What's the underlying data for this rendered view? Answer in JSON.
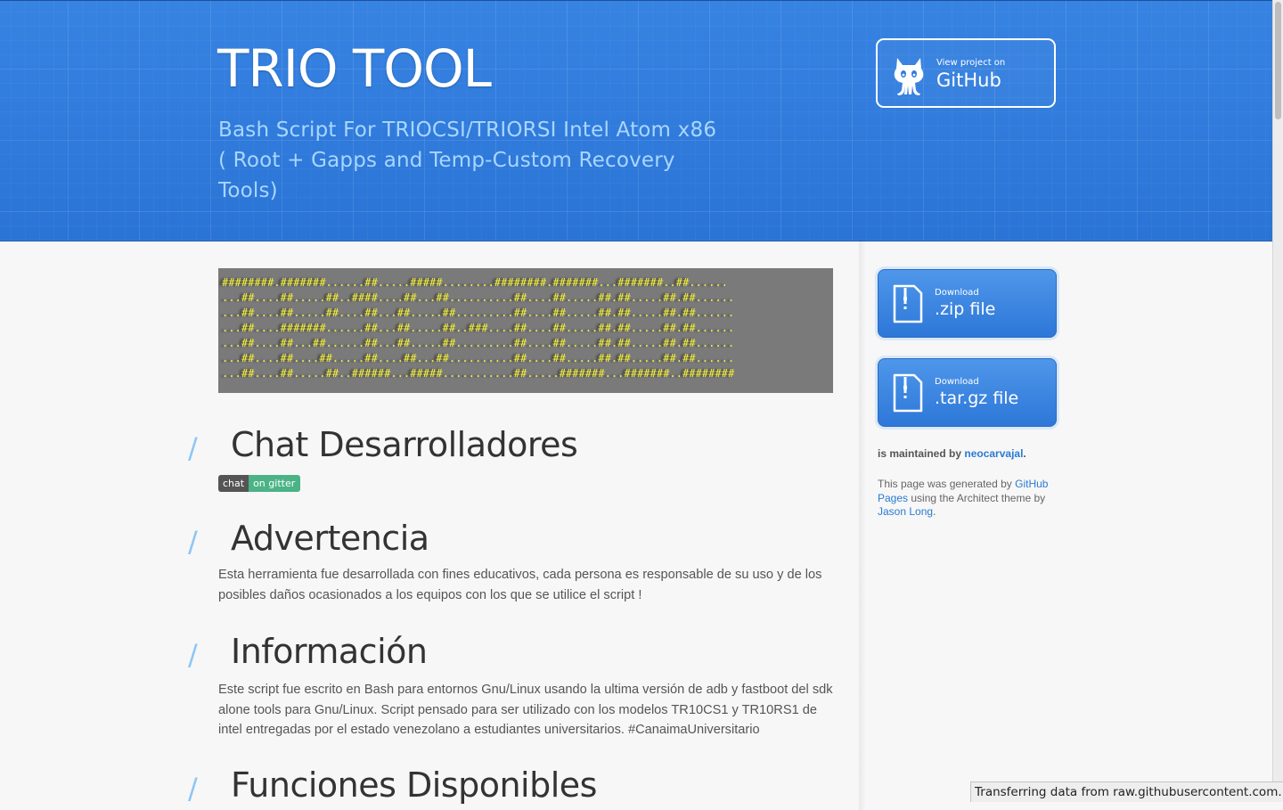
{
  "header": {
    "title": "TRIO TOOL",
    "subtitle": "Bash Script For TRIOCSI/TRIORSI Intel Atom x86 ( Root + Gapps and Temp-Custom Recovery Tools)",
    "github_button": {
      "small": "View project on",
      "big": "GitHub",
      "icon": "octocat-icon"
    }
  },
  "ascii_banner": [
    "########.#######......##.....#####........########.#######...#######..##......",
    "...##....##.....##..####....##...##..........##....##.....##.##.....##.##......",
    "...##....##.....##....##...##.....##.........##....##.....##.##.....##.##......",
    "...##....#######......##...##.....##..###....##....##.....##.##.....##.##......",
    "...##....##...##......##...##.....##.........##....##.....##.##.....##.##......",
    "...##....##....##.....##....##...##..........##....##.....##.##.....##.##......",
    "...##....##.....##..######...#####...........##.....#######...#######..########"
  ],
  "sections": {
    "chat": {
      "heading": "Chat Desarrolladores",
      "badge_left": "chat",
      "badge_right": "on gitter"
    },
    "advertencia": {
      "heading": "Advertencia",
      "text": "Esta herramienta fue desarrollada con fines educativos, cada persona es responsable de su uso y de los posibles daños ocasionados a los equipos con los que se utilice el script !"
    },
    "informacion": {
      "heading": "Información",
      "text": "Este script fue escrito en Bash para entornos Gnu/Linux usando la ultima versión de adb y fastboot del sdk alone tools para Gnu/Linux. Script pensado para ser utilizado con los modelos TR10CS1 y TR10RS1 de intel entregadas por el estado venezolano a estudiantes universitarios. #CanaimaUniversitario"
    },
    "funciones": {
      "heading": "Funciones Disponibles"
    }
  },
  "sidebar": {
    "download_zip": {
      "small": "Download",
      "big": ".zip file",
      "icon": "zip-file-icon"
    },
    "download_targz": {
      "small": "Download",
      "big": ".tar.gz file",
      "icon": "targz-file-icon"
    },
    "maintained_prefix": "is maintained by",
    "maintainer": "neocarvajal",
    "credits_prefix": "This page was generated by",
    "credits_link1": "GitHub Pages",
    "credits_middle": "using the Architect theme by",
    "credits_link2": "Jason Long",
    "credits_suffix": "."
  },
  "status_bar": "Transferring data from raw.githubusercontent.com..."
}
